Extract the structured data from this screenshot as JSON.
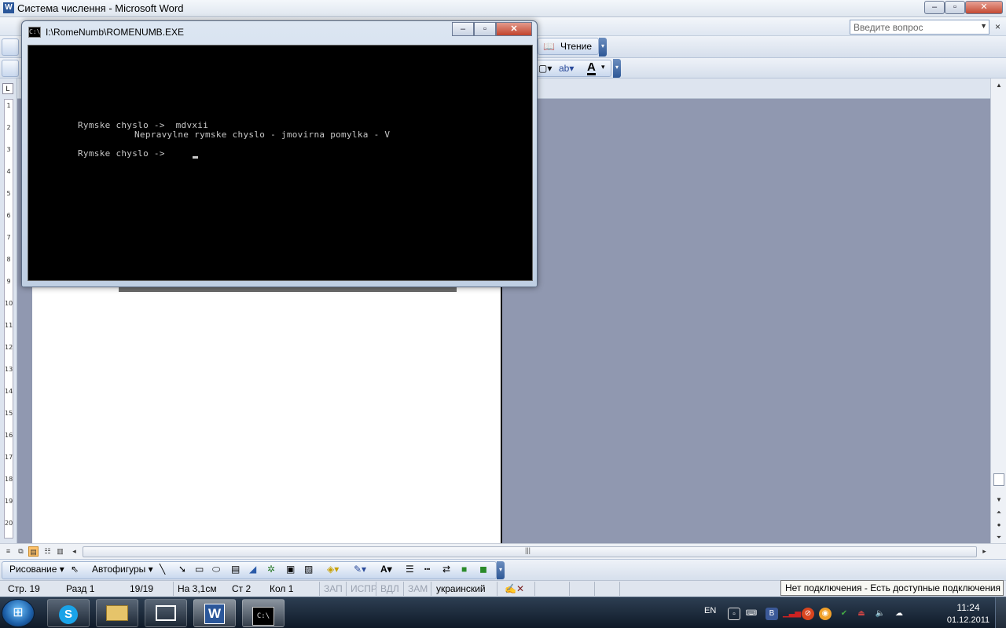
{
  "word_window": {
    "title": "Система числення - Microsoft Word",
    "controls": {
      "minimize": "–",
      "maximize": "▫",
      "close": "✕"
    }
  },
  "menubar": {
    "ask_placeholder": "Введите вопрос",
    "close_doc": "×"
  },
  "toolbar": {
    "reading_label": "Чтение"
  },
  "ruler": {
    "numbers": [
      "1",
      "2",
      "3",
      "4",
      "5",
      "6",
      "7",
      "8",
      "9",
      "10",
      "11",
      "12",
      "13",
      "14",
      "15",
      "16",
      "17",
      "18",
      "19",
      "20"
    ]
  },
  "drawing_toolbar": {
    "drawing_label": "Рисование ▾",
    "autoshapes_label": "Автофигуры ▾"
  },
  "statusbar": {
    "page": "Стр. 19",
    "section": "Разд 1",
    "page_of": "19/19",
    "at": "На 3,1см",
    "line": "Ст 2",
    "column": "Кол 1",
    "rec": "ЗАП",
    "trk": "ИСПР",
    "ext": "ВДЛ",
    "ovr": "ЗАМ",
    "language": "украинский"
  },
  "network_tooltip": "Нет подключения - Есть доступные подключения",
  "console_window": {
    "title": "I:\\RomeNumb\\ROMENUMB.EXE",
    "lines": [
      "Rymske chyslo ->  mdvxii",
      "Nepravylne rymske chyslo - jmovirna pomylka - V",
      "Rymske chyslo ->"
    ]
  },
  "taskbar": {
    "start_label": "⊞",
    "language": "EN",
    "time": "11:24",
    "date": "01.12.2011"
  },
  "colors": {
    "doc_background": "#9098b0",
    "console_background": "#000000",
    "console_text": "#c8c8c8",
    "taskbar": "#1b2838"
  }
}
